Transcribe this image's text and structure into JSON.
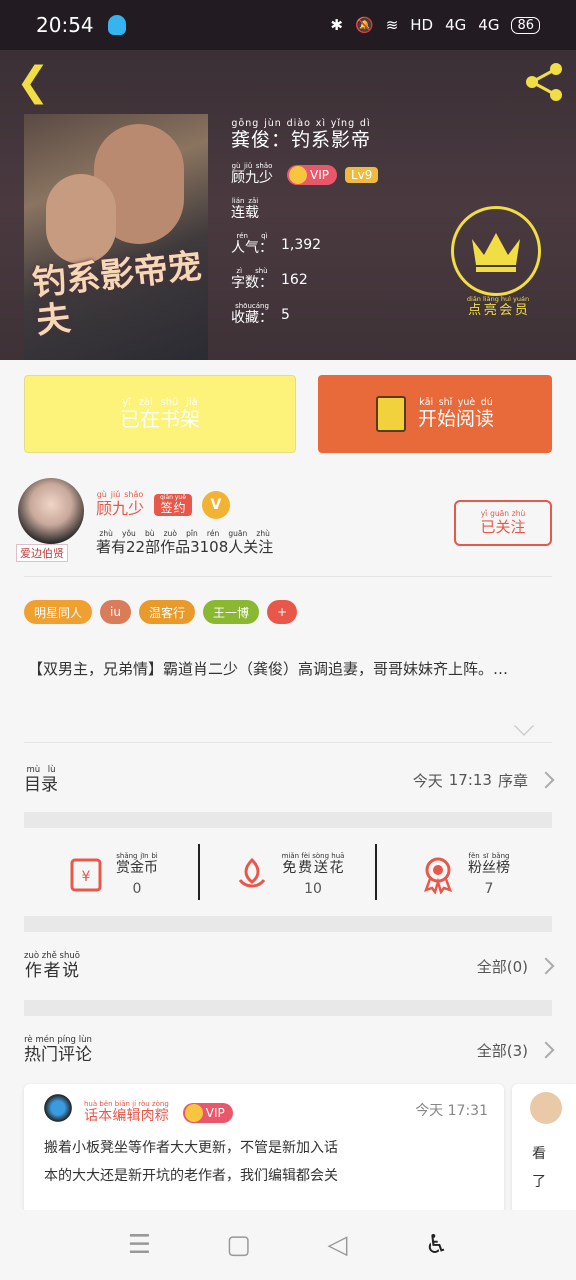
{
  "status": {
    "time": "20:54",
    "hd": "HD",
    "sig1": "4G",
    "sig2": "4G",
    "battery": "86"
  },
  "book": {
    "title": "龚俊：钓系影帝",
    "title_ruby": "gōng jùn  diào xì yǐng dì",
    "author": "顾九少",
    "author_ruby": "gù jiǔ shǎo",
    "vip": "VIP",
    "level": "Lv9",
    "status_label": "连载",
    "status_ruby": "lián zǎi",
    "popularity_label": "人气：",
    "popularity_ruby": "rén qì",
    "popularity": "1,392",
    "words_label": "字数：",
    "words_ruby": "zì shù",
    "words": "162",
    "collect_label": "收藏：",
    "collect_ruby": "shōucáng",
    "collect": "5",
    "cover_title": "钓系影帝宠夫",
    "member_label": "点亮会员",
    "member_ruby": "diǎn liàng huì yuán"
  },
  "actions": {
    "shelf": "已在书架",
    "shelf_ruby": "yǐ zài shū jià",
    "read": "开始阅读",
    "read_ruby": "kāi shǐ yuè dú"
  },
  "author_card": {
    "name": "顾九少",
    "name_ruby": "gù jiǔ shǎo",
    "sign": "签约",
    "sign_ruby": "qiān yuē",
    "badge": "爱边伯贤",
    "stats": "著有22部作品3108人关注",
    "stats_ruby": "zhù yǒu  bù zuò pǐn  rén guān zhù",
    "follow": "已关注",
    "follow_ruby": "yǐ guān zhù"
  },
  "tags": [
    {
      "label": "明星同人",
      "color": "#f0a030"
    },
    {
      "label": "iu",
      "color": "#d87c5a"
    },
    {
      "label": "温客行",
      "color": "#e89a2a"
    },
    {
      "label": "王一博",
      "color": "#8ab830"
    },
    {
      "label": "+",
      "color": "#e8584a"
    }
  ],
  "intro": "【双男主，兄弟情】霸道肖二少（龚俊）高调追妻，哥哥妹妹齐上阵。…",
  "catalog": {
    "label": "目录",
    "label_ruby": "mù lù",
    "time_label": "今天",
    "time": "17:13",
    "chapter": "序章"
  },
  "gifts": [
    {
      "label": "赏金币",
      "ruby": "shǎng jīn bì",
      "value": "0"
    },
    {
      "label": "免费送花",
      "ruby": "miǎn fèi sòng huā",
      "value": "10"
    },
    {
      "label": "粉丝榜",
      "ruby": "fěn sī bǎng",
      "value": "7"
    }
  ],
  "author_says": {
    "label": "作者说",
    "ruby": "zuò zhě shuō",
    "right": "全部(0)"
  },
  "hot": {
    "label": "热门评论",
    "ruby": "rè mén píng lùn",
    "right": "全部(3)"
  },
  "comment": {
    "name": "话本编辑肉粽",
    "name_ruby": "huà běn biān jí ròu zòng",
    "vip": "VIP",
    "time_label": "今天",
    "time": "17:31",
    "text1": "搬着小板凳坐等作者大大更新，不管是新加入话",
    "text2": "本的大大还是新开坑的老作者，我们编辑都会关"
  },
  "comment_peek": {
    "text1": "看",
    "text2": "了"
  }
}
